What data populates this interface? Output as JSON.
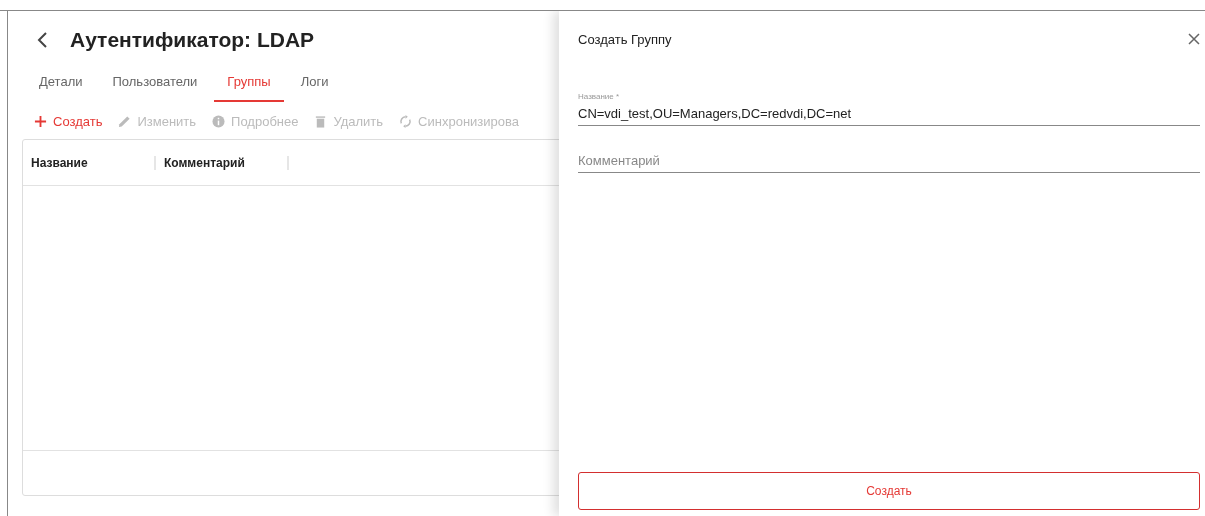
{
  "page": {
    "title": "Аутентификатор: LDAP"
  },
  "tabs": [
    {
      "label": "Детали",
      "selected": false
    },
    {
      "label": "Пользователи",
      "selected": false
    },
    {
      "label": "Группы",
      "selected": true
    },
    {
      "label": "Логи",
      "selected": false
    }
  ],
  "toolbar": [
    {
      "label": "Создать",
      "kind": "plus",
      "disabled": false
    },
    {
      "label": "Изменить",
      "kind": "pencil",
      "disabled": true
    },
    {
      "label": "Подробнее",
      "kind": "info",
      "disabled": true
    },
    {
      "label": "Удалить",
      "kind": "trash",
      "disabled": true
    },
    {
      "label": "Синхронизирова",
      "kind": "sync",
      "disabled": true
    }
  ],
  "table": {
    "columns": [
      "Название",
      "Комментарий"
    ]
  },
  "drawer": {
    "title": "Создать Группу",
    "fields": [
      {
        "label": "Название *",
        "value": "CN=vdi_test,OU=Managers,DC=redvdi,DC=net"
      },
      {
        "placeholder": "Комментарий"
      }
    ],
    "submit": "Создать"
  }
}
